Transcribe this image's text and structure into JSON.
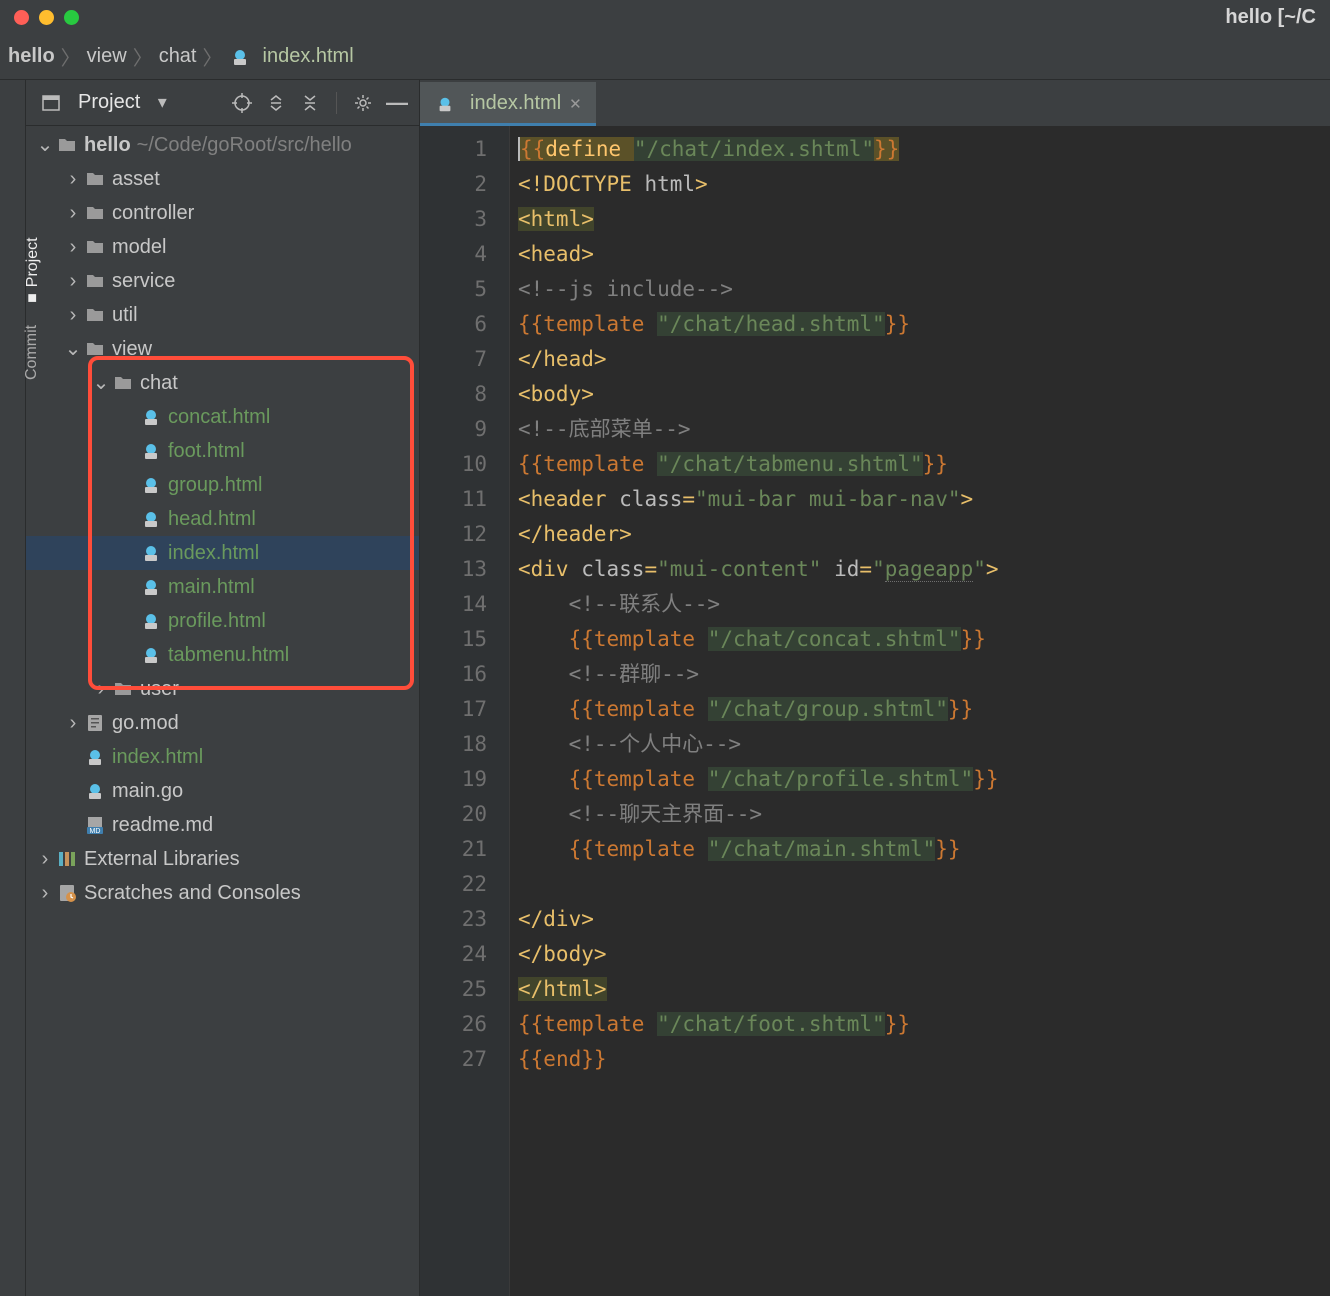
{
  "titlebar": {
    "title": "hello [~/C"
  },
  "breadcrumbs": [
    "hello",
    "view",
    "chat"
  ],
  "breadcrumb_current": "index.html",
  "panel": {
    "title": "Project",
    "root": {
      "name": "hello",
      "path": "~/Code/goRoot/src/hello"
    },
    "folders": [
      "asset",
      "controller",
      "model",
      "service",
      "util",
      "view"
    ],
    "view_children": {
      "chat": {
        "files": [
          "concat.html",
          "foot.html",
          "group.html",
          "head.html",
          "index.html",
          "main.html",
          "profile.html",
          "tabmenu.html"
        ],
        "selected": "index.html"
      },
      "user": {}
    },
    "root_files": [
      {
        "name": "go.mod",
        "type": "mod"
      },
      {
        "name": "index.html",
        "type": "html"
      },
      {
        "name": "main.go",
        "type": "go"
      },
      {
        "name": "readme.md",
        "type": "md"
      }
    ],
    "extras": [
      "External Libraries",
      "Scratches and Consoles"
    ]
  },
  "tabs": [
    {
      "label": "index.html",
      "active": true
    }
  ],
  "code": {
    "lines": [
      "1",
      "2",
      "3",
      "4",
      "5",
      "6",
      "7",
      "8",
      "9",
      "10",
      "11",
      "12",
      "13",
      "14",
      "15",
      "16",
      "17",
      "18",
      "19",
      "20",
      "21",
      "22",
      "23",
      "24",
      "25",
      "26",
      "27"
    ],
    "l1_kw": "define",
    "l1_str": "\"/chat/index.shtml\"",
    "l2": "<!DOCTYPE html>",
    "l3": "<html>",
    "l4": "<head>",
    "l5": "<!--js include-->",
    "l6_kw": "template",
    "l6_str": "\"/chat/head.shtml\"",
    "l7": "</head>",
    "l8": "<body>",
    "l9": "<!--底部菜单-->",
    "l10_kw": "template",
    "l10_str": "\"/chat/tabmenu.shtml\"",
    "l11_a": "<header ",
    "l11_b": "class",
    "l11_c": "=",
    "l11_d": "\"mui-bar mui-bar-nav\"",
    "l11_e": ">",
    "l12": "</header>",
    "l13_a": "<div ",
    "l13_b": "class",
    "l13_c": "=",
    "l13_d": "\"mui-content\" ",
    "l13_e": "id",
    "l13_f": "=",
    "l13_g": "\"pageapp\"",
    "l13_h": ">",
    "l14": "<!--联系人-->",
    "l15_kw": "template",
    "l15_str": "\"/chat/concat.shtml\"",
    "l16": "<!--群聊-->",
    "l17_kw": "template",
    "l17_str": "\"/chat/group.shtml\"",
    "l18": "<!--个人中心-->",
    "l19_kw": "template",
    "l19_str": "\"/chat/profile.shtml\"",
    "l20": "<!--聊天主界面-->",
    "l21_kw": "template",
    "l21_str": "\"/chat/main.shtml\"",
    "l23": "</div>",
    "l24": "</body>",
    "l25": "</html>",
    "l26_kw": "template",
    "l26_str": "\"/chat/foot.shtml\"",
    "l27_kw": "end"
  },
  "side_tabs": [
    "Commit",
    "Project"
  ]
}
